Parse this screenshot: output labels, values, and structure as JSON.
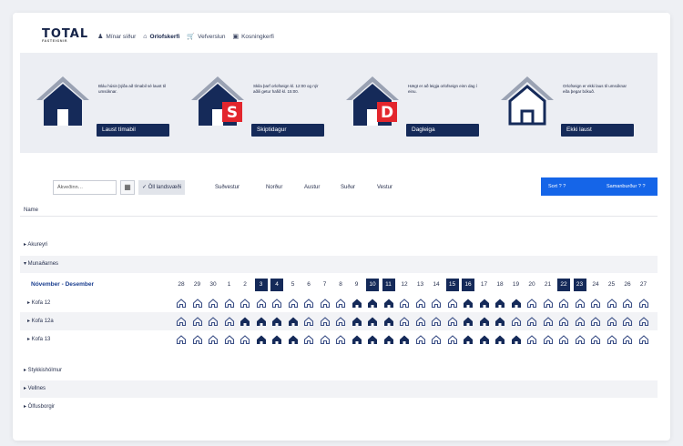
{
  "brand": {
    "name": "TOTAL",
    "tagline": "FASTEIGNIR"
  },
  "nav": [
    {
      "label": "Mínar síður",
      "icon": "user-icon",
      "active": false
    },
    {
      "label": "Orlofskerfi",
      "icon": "home-icon",
      "active": true
    },
    {
      "label": "Vefverslun",
      "icon": "cart-icon",
      "active": false
    },
    {
      "label": "Kosningkerfi",
      "icon": "ballot-icon",
      "active": false
    }
  ],
  "legend": [
    {
      "desc": "Bláu húsin þýða að tímabil sé laust til umsóknar.",
      "button": "Laust tímabil",
      "badge": "",
      "style": "dark",
      "icon": "house-icon"
    },
    {
      "desc": "Skila þarf orlofseign kl. 12:00 og nýr aðili getur hafið kl. 15:00.",
      "button": "Skiptidagur",
      "badge": "S",
      "style": "dark",
      "icon": "house-swap-icon"
    },
    {
      "desc": "Hægt er að leigja orlofseign einn dag í einu.",
      "button": "Dagleiga",
      "badge": "D",
      "style": "dark",
      "icon": "house-day-icon"
    },
    {
      "desc": "Orlofseign er ekki laus til umsóknar eða þegar bókuð.",
      "button": "Ekki laust",
      "badge": "",
      "style": "outline",
      "icon": "house-outline-icon"
    }
  ],
  "filters": {
    "search_placeholder": "Ákveðinn…",
    "chips": [
      {
        "label": "✓ Öll landsvæði",
        "active": true
      },
      {
        "label": "Suðvestur",
        "active": false
      },
      {
        "label": "Norður",
        "active": false
      },
      {
        "label": "Austur",
        "active": false
      },
      {
        "label": "Suður",
        "active": false
      },
      {
        "label": "Vestur",
        "active": false
      }
    ],
    "sort_label": "Sort ? ?",
    "group_label": "Samanburður ? ?"
  },
  "table": {
    "name_header": "Name",
    "groups": [
      {
        "label": "▸ Akureyri",
        "expanded": false
      },
      {
        "label": "▾ Munaðarnes",
        "expanded": true
      }
    ],
    "month_label": "Nóvember - Desember",
    "days": [
      "28",
      "29",
      "30",
      "1",
      "2",
      "3",
      "4",
      "5",
      "6",
      "7",
      "8",
      "9",
      "10",
      "11",
      "12",
      "13",
      "14",
      "15",
      "16",
      "17",
      "18",
      "19",
      "20",
      "21",
      "22",
      "23",
      "24",
      "25",
      "26",
      "27"
    ],
    "highlighted_days": [
      5,
      6,
      12,
      13,
      17,
      18,
      24,
      25
    ],
    "units": [
      {
        "label": "▸ Kofa 12",
        "booked": [
          11,
          12,
          13,
          18,
          19,
          20,
          21
        ]
      },
      {
        "label": "▸ Kofa 12a",
        "booked": [
          4,
          5,
          6,
          7,
          11,
          12,
          13,
          18,
          19,
          20
        ]
      },
      {
        "label": "▸ Kofa 13",
        "booked": [
          5,
          6,
          7,
          11,
          12,
          13,
          14,
          18,
          19,
          20,
          21
        ]
      }
    ],
    "more_groups": [
      {
        "label": "▸ Stykkishólmur"
      },
      {
        "label": "▸ Vellnes"
      },
      {
        "label": "▸ Ölfusborgir"
      }
    ]
  }
}
